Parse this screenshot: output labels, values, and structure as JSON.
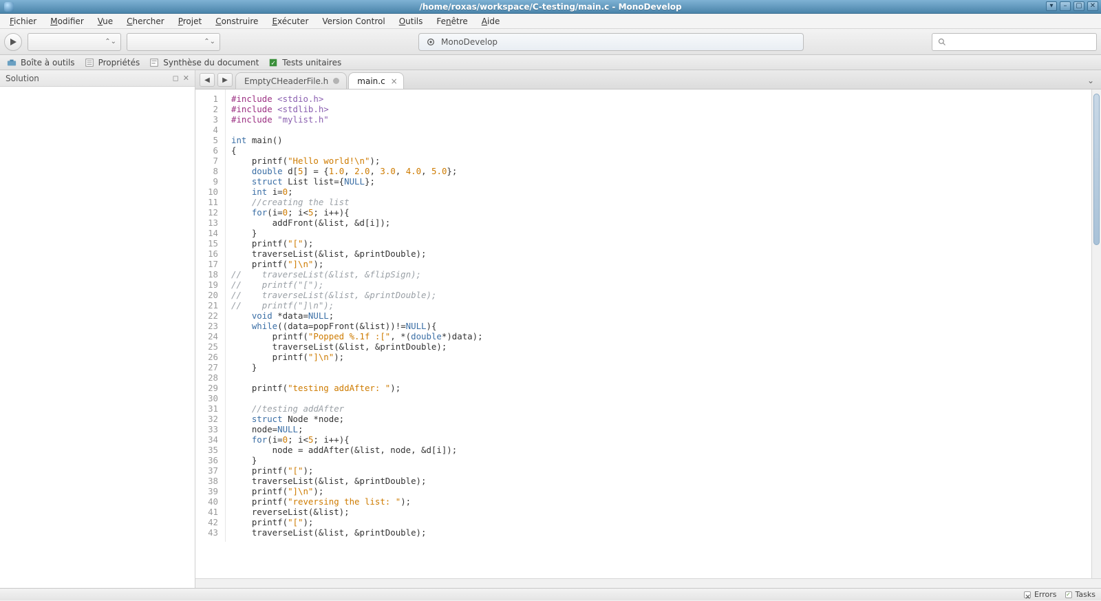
{
  "window": {
    "title": "/home/roxas/workspace/C-testing/main.c - MonoDevelop"
  },
  "menu": {
    "items": [
      {
        "label": "Fichier",
        "u": 0
      },
      {
        "label": "Modifier",
        "u": 0
      },
      {
        "label": "Vue",
        "u": 0
      },
      {
        "label": "Chercher",
        "u": 0
      },
      {
        "label": "Projet",
        "u": 0
      },
      {
        "label": "Construire",
        "u": 0
      },
      {
        "label": "Exécuter",
        "u": 0
      },
      {
        "label": "Version Control",
        "u": -1
      },
      {
        "label": "Outils",
        "u": 0
      },
      {
        "label": "Fenêtre",
        "u": 2
      },
      {
        "label": "Aide",
        "u": 0
      }
    ]
  },
  "toolbar": {
    "center_text": "MonoDevelop",
    "search_placeholder": ""
  },
  "pads": {
    "toolbox": "Boîte à outils",
    "properties": "Propriétés",
    "outline": "Synthèse du document",
    "unit_tests": "Tests unitaires"
  },
  "sidebar": {
    "title": "Solution"
  },
  "tabs": {
    "items": [
      {
        "label": "EmptyCHeaderFile.h",
        "active": false,
        "dirty": true
      },
      {
        "label": "main.c",
        "active": true,
        "dirty": false
      }
    ]
  },
  "statusbar": {
    "errors_label": "Errors",
    "tasks_label": "Tasks"
  },
  "code": {
    "lines": [
      {
        "n": 1,
        "t": [
          [
            "macro",
            "#include "
          ],
          [
            "incpath",
            "<stdio.h>"
          ]
        ]
      },
      {
        "n": 2,
        "t": [
          [
            "macro",
            "#include "
          ],
          [
            "incpath",
            "<stdlib.h>"
          ]
        ]
      },
      {
        "n": 3,
        "t": [
          [
            "macro",
            "#include "
          ],
          [
            "incpath",
            "\"mylist.h\""
          ]
        ]
      },
      {
        "n": 4,
        "t": [
          [
            "p",
            ""
          ]
        ]
      },
      {
        "n": 5,
        "t": [
          [
            "kw",
            "int"
          ],
          [
            "p",
            " main()"
          ]
        ]
      },
      {
        "n": 6,
        "t": [
          [
            "p",
            "{"
          ]
        ]
      },
      {
        "n": 7,
        "t": [
          [
            "p",
            "    printf("
          ],
          [
            "str",
            "\"Hello world!\\n\""
          ],
          [
            "p",
            ");"
          ]
        ]
      },
      {
        "n": 8,
        "t": [
          [
            "p",
            "    "
          ],
          [
            "kw",
            "double"
          ],
          [
            "p",
            " d["
          ],
          [
            "num",
            "5"
          ],
          [
            "p",
            "] = {"
          ],
          [
            "num",
            "1.0"
          ],
          [
            "p",
            ", "
          ],
          [
            "num",
            "2.0"
          ],
          [
            "p",
            ", "
          ],
          [
            "num",
            "3.0"
          ],
          [
            "p",
            ", "
          ],
          [
            "num",
            "4.0"
          ],
          [
            "p",
            ", "
          ],
          [
            "num",
            "5.0"
          ],
          [
            "p",
            "};"
          ]
        ]
      },
      {
        "n": 9,
        "t": [
          [
            "p",
            "    "
          ],
          [
            "kw",
            "struct"
          ],
          [
            "p",
            " List list={"
          ],
          [
            "null",
            "NULL"
          ],
          [
            "p",
            "};"
          ]
        ]
      },
      {
        "n": 10,
        "t": [
          [
            "p",
            "    "
          ],
          [
            "kw",
            "int"
          ],
          [
            "p",
            " i="
          ],
          [
            "num",
            "0"
          ],
          [
            "p",
            ";"
          ]
        ]
      },
      {
        "n": 11,
        "t": [
          [
            "p",
            "    "
          ],
          [
            "cmt",
            "//creating the list"
          ]
        ]
      },
      {
        "n": 12,
        "t": [
          [
            "p",
            "    "
          ],
          [
            "kw",
            "for"
          ],
          [
            "p",
            "(i="
          ],
          [
            "num",
            "0"
          ],
          [
            "p",
            "; i<"
          ],
          [
            "num",
            "5"
          ],
          [
            "p",
            "; i++){"
          ]
        ]
      },
      {
        "n": 13,
        "t": [
          [
            "p",
            "        addFront(&list, &d[i]);"
          ]
        ]
      },
      {
        "n": 14,
        "t": [
          [
            "p",
            "    }"
          ]
        ]
      },
      {
        "n": 15,
        "t": [
          [
            "p",
            "    printf("
          ],
          [
            "str",
            "\"[\""
          ],
          [
            "p",
            ");"
          ]
        ]
      },
      {
        "n": 16,
        "t": [
          [
            "p",
            "    traverseList(&list, &printDouble);"
          ]
        ]
      },
      {
        "n": 17,
        "t": [
          [
            "p",
            "    printf("
          ],
          [
            "str",
            "\"]\\n\""
          ],
          [
            "p",
            ");"
          ]
        ]
      },
      {
        "n": 18,
        "t": [
          [
            "cmt",
            "//    traverseList(&list, &flipSign);"
          ]
        ]
      },
      {
        "n": 19,
        "t": [
          [
            "cmt",
            "//    printf(\"[\");"
          ]
        ]
      },
      {
        "n": 20,
        "t": [
          [
            "cmt",
            "//    traverseList(&list, &printDouble);"
          ]
        ]
      },
      {
        "n": 21,
        "t": [
          [
            "cmt",
            "//    printf(\"]\\n\");"
          ]
        ]
      },
      {
        "n": 22,
        "t": [
          [
            "p",
            "    "
          ],
          [
            "kw",
            "void"
          ],
          [
            "p",
            " *data="
          ],
          [
            "null",
            "NULL"
          ],
          [
            "p",
            ";"
          ]
        ]
      },
      {
        "n": 23,
        "t": [
          [
            "p",
            "    "
          ],
          [
            "kw",
            "while"
          ],
          [
            "p",
            "((data=popFront(&list))!="
          ],
          [
            "null",
            "NULL"
          ],
          [
            "p",
            "){"
          ]
        ]
      },
      {
        "n": 24,
        "t": [
          [
            "p",
            "        printf("
          ],
          [
            "str",
            "\"Popped %.1f :[\""
          ],
          [
            "p",
            ", *("
          ],
          [
            "kw",
            "double"
          ],
          [
            "p",
            "*)data);"
          ]
        ]
      },
      {
        "n": 25,
        "t": [
          [
            "p",
            "        traverseList(&list, &printDouble);"
          ]
        ]
      },
      {
        "n": 26,
        "t": [
          [
            "p",
            "        printf("
          ],
          [
            "str",
            "\"]\\n\""
          ],
          [
            "p",
            ");"
          ]
        ]
      },
      {
        "n": 27,
        "t": [
          [
            "p",
            "    }"
          ]
        ]
      },
      {
        "n": 28,
        "t": [
          [
            "p",
            ""
          ]
        ]
      },
      {
        "n": 29,
        "t": [
          [
            "p",
            "    printf("
          ],
          [
            "str",
            "\"testing addAfter: \""
          ],
          [
            "p",
            ");"
          ]
        ]
      },
      {
        "n": 30,
        "t": [
          [
            "p",
            ""
          ]
        ]
      },
      {
        "n": 31,
        "t": [
          [
            "p",
            "    "
          ],
          [
            "cmt",
            "//testing addAfter"
          ]
        ]
      },
      {
        "n": 32,
        "t": [
          [
            "p",
            "    "
          ],
          [
            "kw",
            "struct"
          ],
          [
            "p",
            " Node *node;"
          ]
        ]
      },
      {
        "n": 33,
        "t": [
          [
            "p",
            "    node="
          ],
          [
            "null",
            "NULL"
          ],
          [
            "p",
            ";"
          ]
        ]
      },
      {
        "n": 34,
        "t": [
          [
            "p",
            "    "
          ],
          [
            "kw",
            "for"
          ],
          [
            "p",
            "(i="
          ],
          [
            "num",
            "0"
          ],
          [
            "p",
            "; i<"
          ],
          [
            "num",
            "5"
          ],
          [
            "p",
            "; i++){"
          ]
        ]
      },
      {
        "n": 35,
        "t": [
          [
            "p",
            "        node = addAfter(&list, node, &d[i]);"
          ]
        ]
      },
      {
        "n": 36,
        "t": [
          [
            "p",
            "    }"
          ]
        ]
      },
      {
        "n": 37,
        "t": [
          [
            "p",
            "    printf("
          ],
          [
            "str",
            "\"[\""
          ],
          [
            "p",
            ");"
          ]
        ]
      },
      {
        "n": 38,
        "t": [
          [
            "p",
            "    traverseList(&list, &printDouble);"
          ]
        ]
      },
      {
        "n": 39,
        "t": [
          [
            "p",
            "    printf("
          ],
          [
            "str",
            "\"]\\n\""
          ],
          [
            "p",
            ");"
          ]
        ]
      },
      {
        "n": 40,
        "t": [
          [
            "p",
            "    printf("
          ],
          [
            "str",
            "\"reversing the list: \""
          ],
          [
            "p",
            ");"
          ]
        ]
      },
      {
        "n": 41,
        "t": [
          [
            "p",
            "    reverseList(&list);"
          ]
        ]
      },
      {
        "n": 42,
        "t": [
          [
            "p",
            "    printf("
          ],
          [
            "str",
            "\"[\""
          ],
          [
            "p",
            ");"
          ]
        ]
      },
      {
        "n": 43,
        "t": [
          [
            "p",
            "    traverseList(&list, &printDouble);"
          ]
        ]
      }
    ]
  }
}
